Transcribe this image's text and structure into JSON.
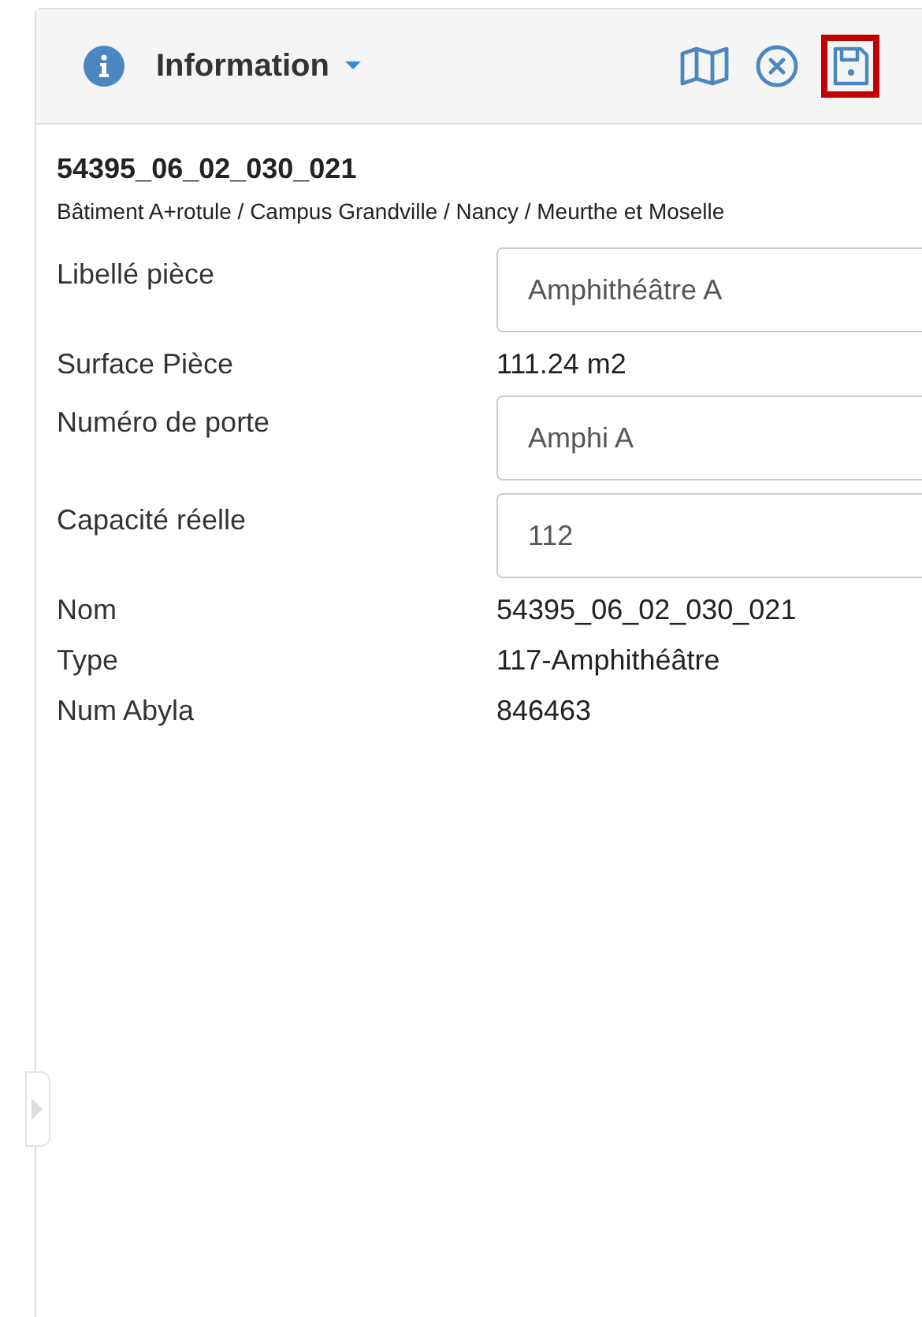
{
  "header": {
    "title": "Information",
    "actions": [
      {
        "kind": "map",
        "highlighted": false
      },
      {
        "kind": "close",
        "highlighted": false
      },
      {
        "kind": "save",
        "highlighted": true
      }
    ]
  },
  "record": {
    "code": "54395_06_02_030_021",
    "path": "Bâtiment A+rotule / Campus Grandville / Nancy / Meurthe et Moselle"
  },
  "fields": [
    {
      "label": "Libellé pièce",
      "value": "Amphithéâtre A",
      "kind": "input"
    },
    {
      "label": "Surface Pièce",
      "value": "111.24 m2",
      "kind": "text"
    },
    {
      "label": "Numéro de porte",
      "value": "Amphi A",
      "kind": "input"
    },
    {
      "label": "Capacité réelle",
      "value": "112",
      "kind": "input"
    },
    {
      "label": "Nom",
      "value": "54395_06_02_030_021",
      "kind": "text"
    },
    {
      "label": "Type",
      "value": "117-Amphithéâtre",
      "kind": "text"
    },
    {
      "label": "Num Abyla",
      "value": "846463",
      "kind": "text"
    }
  ]
}
